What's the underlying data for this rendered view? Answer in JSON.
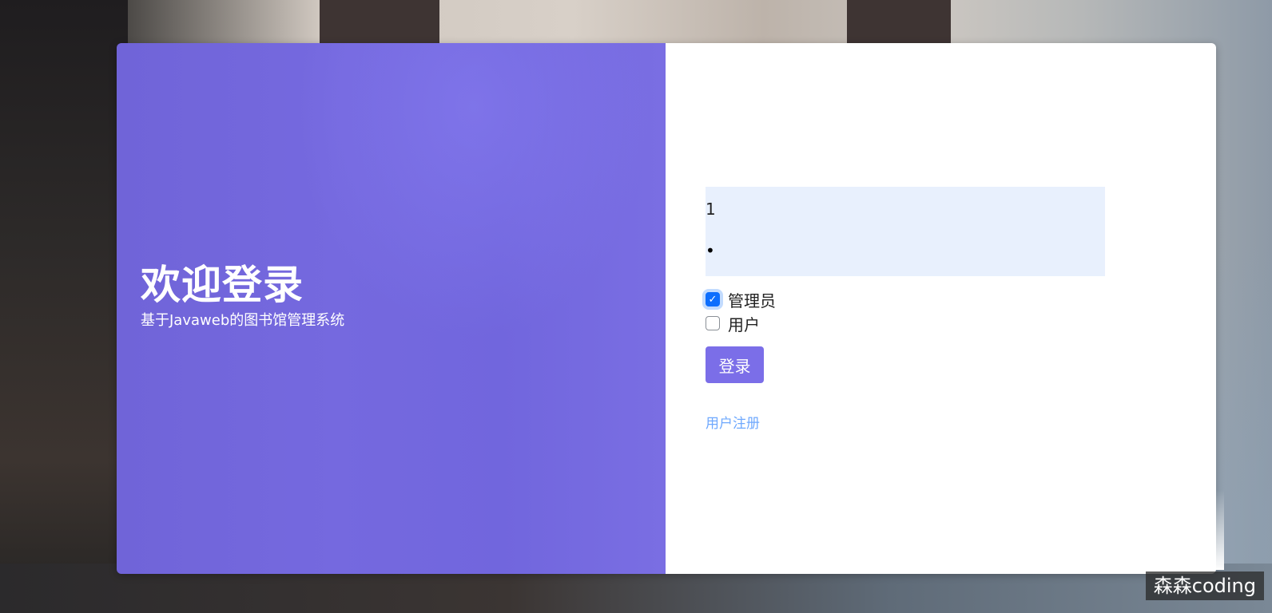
{
  "welcome": {
    "title": "欢迎登录",
    "subtitle": "基于Javaweb的图书馆管理系统"
  },
  "form": {
    "username_value": "1",
    "password_value": "•",
    "roles": [
      {
        "label": "管理员",
        "checked": true
      },
      {
        "label": "用户",
        "checked": false
      }
    ],
    "login_label": "登录",
    "register_label": "用户注册"
  },
  "watermark": {
    "text": "森森coding"
  },
  "colors": {
    "left_panel": "#7166dd",
    "button": "#7b6ee8",
    "checkbox_checked": "#0d6efd",
    "link": "#6ea8fe",
    "input_background": "#e8f0fd"
  },
  "icons": {
    "check": "check-icon"
  }
}
